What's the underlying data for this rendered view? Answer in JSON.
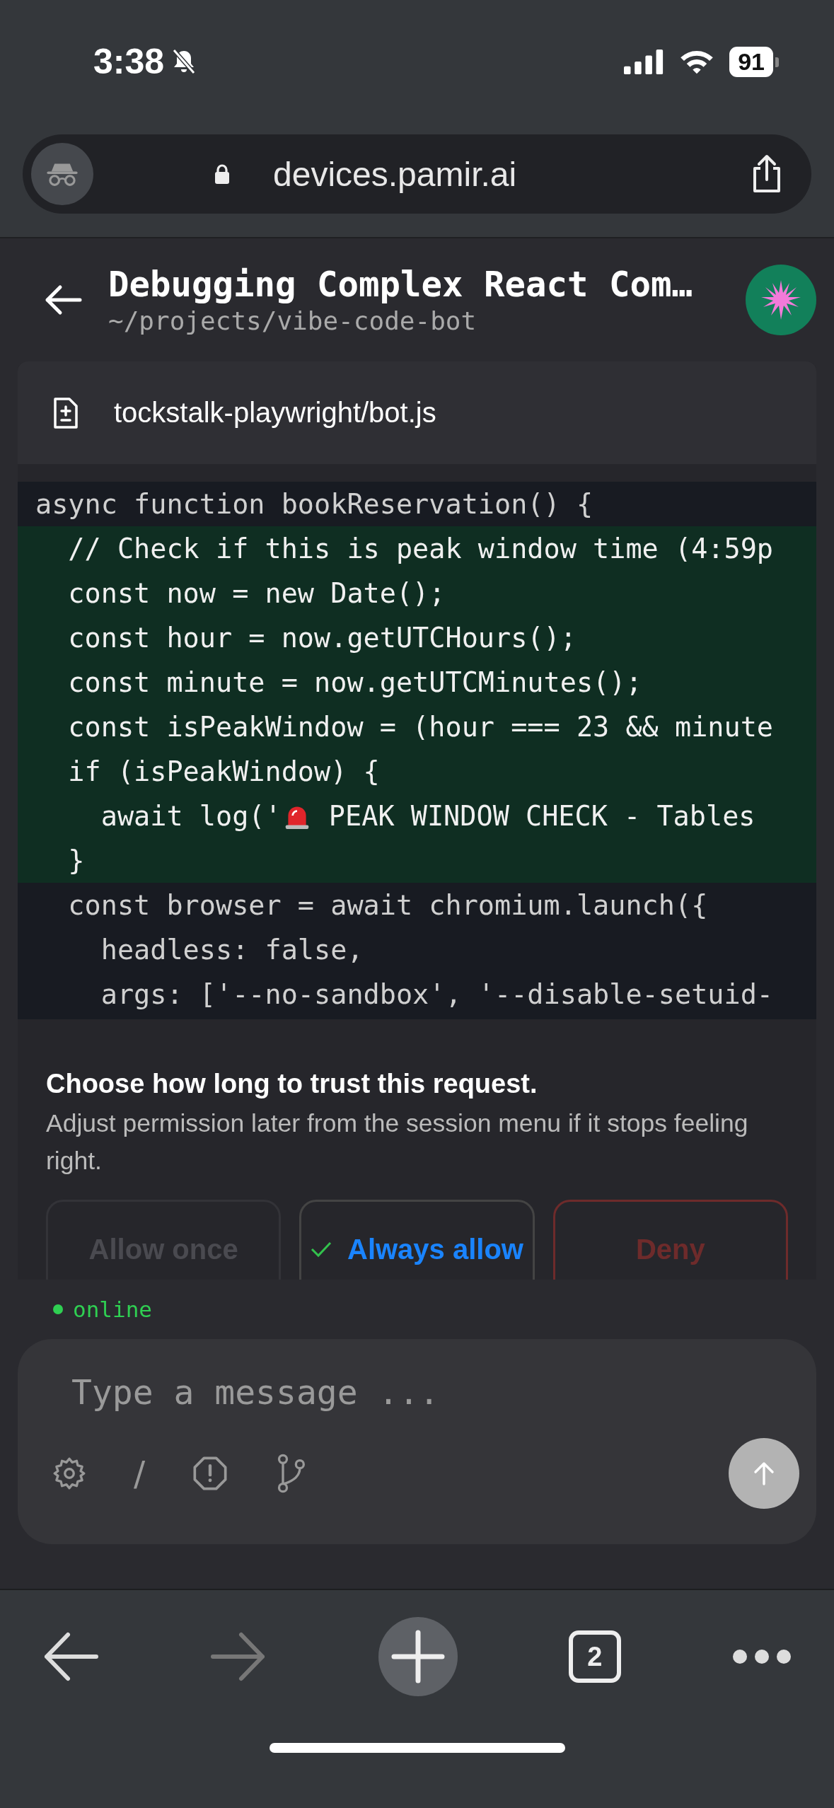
{
  "status_bar": {
    "time": "3:38",
    "silent": true,
    "battery": "91"
  },
  "browser_bar": {
    "url": "devices.pamir.ai"
  },
  "header": {
    "title": "Debugging Complex React Com…",
    "subtitle": "~/projects/vibe-code-bot"
  },
  "file": {
    "path": "tockstalk-playwright/bot.js"
  },
  "code_lines": [
    {
      "text": "async function bookReservation() {",
      "added": false
    },
    {
      "text": "  // Check if this is peak window time (4:59p",
      "added": true
    },
    {
      "text": "  const now = new Date();",
      "added": true
    },
    {
      "text": "  const hour = now.getUTCHours();",
      "added": true
    },
    {
      "text": "  const minute = now.getUTCMinutes();",
      "added": true
    },
    {
      "text": "  const isPeakWindow = (hour === 23 && minute",
      "added": true
    },
    {
      "text": "  if (isPeakWindow) {",
      "added": true
    },
    {
      "text": "    await log('",
      "added": true,
      "kind": "emoji",
      "text_after": " PEAK WINDOW CHECK - Tables"
    },
    {
      "text": "  }",
      "added": true
    },
    {
      "text": "  const browser = await chromium.launch({",
      "added": false
    },
    {
      "text": "    headless: false,",
      "added": false
    },
    {
      "text": "    args: ['--no-sandbox', '--disable-setuid-",
      "added": false
    }
  ],
  "permission": {
    "heading": "Choose how long to trust this request.",
    "body": "Adjust permission later from the session menu if it stops feeling right.",
    "options": [
      {
        "label": "Allow once",
        "kind": "neutral",
        "selected": false
      },
      {
        "label": "Always allow",
        "kind": "allow",
        "selected": true
      },
      {
        "label": "Deny",
        "kind": "deny",
        "selected": false
      }
    ]
  },
  "connection": {
    "status": "online",
    "online": true
  },
  "composer": {
    "placeholder": "Type a message ...",
    "slash": "/"
  },
  "bottom_nav": {
    "tabs_count": "2",
    "forward_disabled": true
  }
}
